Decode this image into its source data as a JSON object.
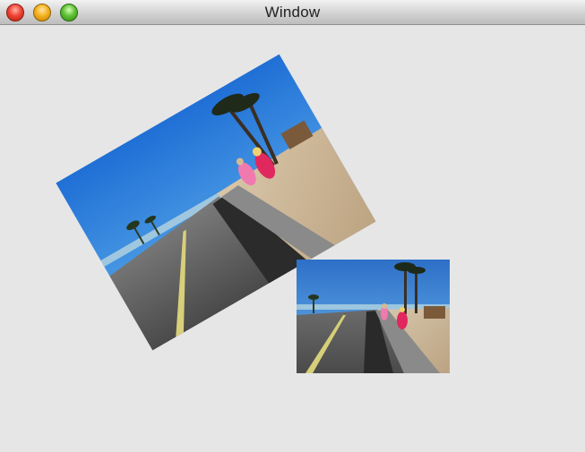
{
  "window": {
    "title": "Window"
  },
  "images": [
    {
      "name": "large-rotated-photo",
      "rotation_deg": -30
    },
    {
      "name": "small-photo",
      "rotation_deg": 0
    }
  ]
}
